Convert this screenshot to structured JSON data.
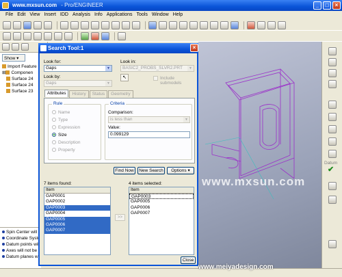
{
  "window": {
    "site": "www.mxsun.com",
    "app_title": "- Pro/ENGINEER"
  },
  "menu": [
    "File",
    "Edit",
    "View",
    "Insert",
    "IDD",
    "Analysis",
    "Info",
    "Applications",
    "Tools",
    "Window",
    "Help"
  ],
  "left_panel": {
    "show_label": "Show",
    "tree": [
      "Import Feature",
      "Componen",
      "Surface 24",
      "Surface 24",
      "Surface 23"
    ]
  },
  "messages": [
    "Spin Center will n",
    "Coordinate Syste",
    "Datum points will",
    "Axes will not be",
    "Datum planes wil"
  ],
  "right_toolbar": {
    "datum_label": "Datum"
  },
  "dialog": {
    "title": "Search Tool:1",
    "look_for_label": "Look for:",
    "look_for_value": "Gaps",
    "look_in_label": "Look in:",
    "look_in_value": "BASIC2_PROBS_SLVR2.PRT",
    "look_by_label": "Look by:",
    "look_by_value": "Gaps",
    "include_submodels": "Include submodels",
    "tabs": [
      "Attributes",
      "History",
      "Status",
      "Geometry"
    ],
    "rule": {
      "title": "Rule",
      "options": [
        "Name",
        "Type",
        "Expression",
        "Size",
        "Description",
        "Property"
      ],
      "selected": "Size"
    },
    "criteria": {
      "title": "Criteria",
      "comparison_label": "Comparison:",
      "comparison_value": "is less than",
      "value_label": "Value:",
      "value": "0.099129"
    },
    "find_now": "Find Now",
    "new_search": "New Search",
    "options": "Options",
    "found_label": "7 items found:",
    "selected_label": "4 items selected:",
    "column_item": "Item",
    "found_items": [
      "GAP0001",
      "GAP0002",
      "GAP0003",
      "GAP0004",
      "GAP0005",
      "GAP0006",
      "GAP0007"
    ],
    "found_selected": [
      false,
      false,
      true,
      false,
      true,
      true,
      true
    ],
    "selected_items": [
      "GAP0003",
      "GAP0005",
      "GAP0006",
      "GAP0007"
    ],
    "move_label": ">>",
    "close": "Close"
  },
  "watermarks": {
    "center": "www.mxsun.com",
    "bottom": "www.meiyadesign.com"
  }
}
